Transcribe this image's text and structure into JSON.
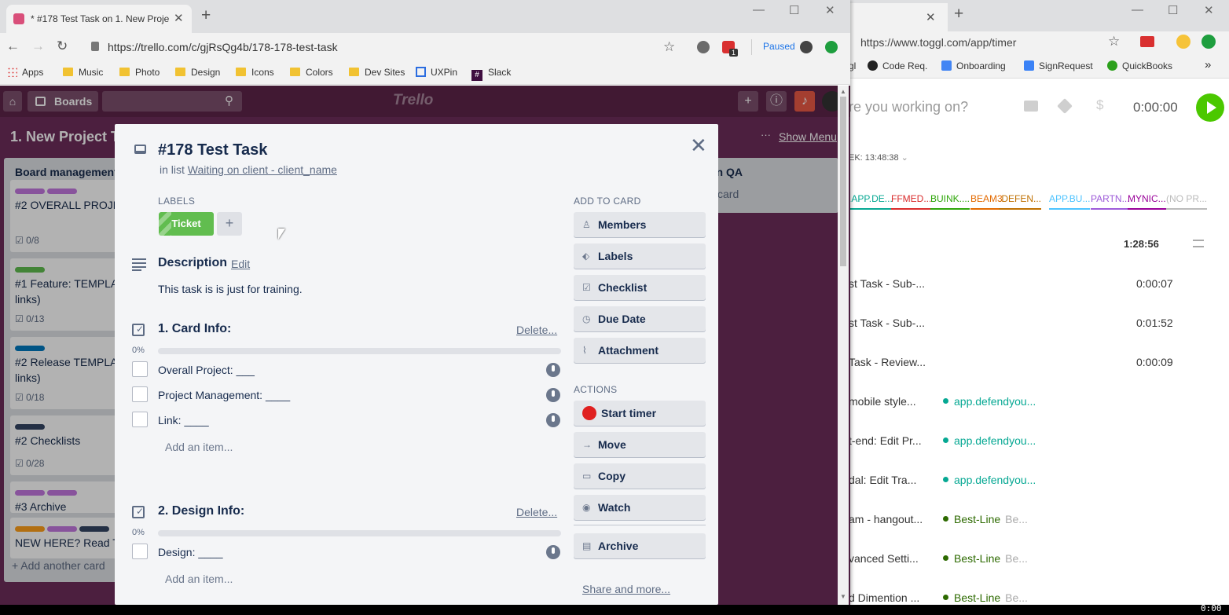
{
  "toggl_window": {
    "new_tab": "+",
    "url": "https://www.toggl.com/app/timer",
    "bookmarks": [
      "Code Req.",
      "Onboarding",
      "SignRequest",
      "QuickBooks"
    ],
    "bookmarks_more": "»",
    "prompt": "re you working on?",
    "timer": "0:00:00",
    "week_total": "EK: 13:48:38",
    "projects": [
      {
        "label": ".APP.DE...",
        "color": "#06a893"
      },
      {
        "label": "FFMED...",
        "color": "#d92b2b"
      },
      {
        "label": "BUINK....",
        "color": "#2da608"
      },
      {
        "label": "BEAM3",
        "color": "#e36a00"
      },
      {
        "label": ".DEFEN...",
        "color": "#bf7000"
      },
      {
        "label": "APP.BU...",
        "color": "#4dc3ff"
      },
      {
        "label": "PARTN...",
        "color": "#9e5bd9"
      },
      {
        "label": "MYNIC...",
        "color": "#990099"
      },
      {
        "label": "(NO PR...",
        "color": "#bbbbbb"
      }
    ],
    "day_total": "1:28:56",
    "entries": [
      {
        "desc": "st Task - Sub-...",
        "dur": "0:00:07",
        "project": "",
        "client": ""
      },
      {
        "desc": "st Task - Sub-...",
        "dur": "0:01:52",
        "project": "",
        "client": ""
      },
      {
        "desc": "Task - Review...",
        "dur": "0:00:09",
        "project": "",
        "client": ""
      },
      {
        "desc": "mobile style...",
        "dur": "",
        "project": "app.defendyou...",
        "client": "",
        "color": "#06a893"
      },
      {
        "desc": "t-end: Edit Pr...",
        "dur": "",
        "project": "app.defendyou...",
        "client": "",
        "color": "#06a893"
      },
      {
        "desc": "dal: Edit Tra...",
        "dur": "",
        "project": "app.defendyou...",
        "client": "",
        "color": "#06a893"
      },
      {
        "desc": "am - hangout...",
        "dur": "",
        "project": "Best-Line",
        "client": "Be...",
        "color": "#2d6a00"
      },
      {
        "desc": "vanced Setti...",
        "dur": "",
        "project": "Best-Line",
        "client": "Be...",
        "color": "#2d6a00"
      },
      {
        "desc": "d Dimention ...",
        "dur": "",
        "project": "Best-Line",
        "client": "Be...",
        "color": "#2d6a00"
      }
    ]
  },
  "trello_window": {
    "tab_title": "* #178 Test Task on 1. New Proje",
    "new_tab": "+",
    "url": "https://trello.com/c/gjRsQg4b/178-178-test-task",
    "extension_badge": "1",
    "paused_label": "Paused",
    "bookmarks": [
      "Apps",
      "Music",
      "Photo",
      "Design",
      "Icons",
      "Colors",
      "Dev Sites",
      "UXPin",
      "Slack"
    ],
    "header": {
      "boards": "Boards",
      "logo": "Trello"
    },
    "board": {
      "name": "1. New Project T",
      "show_menu": "Show Menu",
      "column1_title": "Board management",
      "cards": [
        {
          "title": "#2 OVERALL PROJE",
          "badge": "0/8",
          "bars": [
            "#c377e0",
            "#c377e0"
          ]
        },
        {
          "title": "#1 Feature: TEMPLA links)",
          "badge": "0/13",
          "bars": [
            "#61bd4f"
          ]
        },
        {
          "title": "#2 Release TEMPLA links)",
          "badge": "0/18",
          "bars": [
            "#0079bf"
          ]
        },
        {
          "title": "#2 Checklists",
          "badge": "0/28",
          "bars": [
            "#344563"
          ]
        },
        {
          "title": "#3 Archive",
          "badge": "",
          "bars": [
            "#c377e0",
            "#c377e0"
          ]
        },
        {
          "title": "NEW HERE? Read T",
          "badge": "",
          "bars": [
            "#ff9f1a",
            "#c377e0",
            "#344563"
          ]
        }
      ],
      "add_card": "+ Add another card",
      "column2_title": "on QA",
      "column2_sub": "card"
    },
    "modal": {
      "title": "#178 Test Task",
      "in_list_prefix": "in list",
      "in_list_link": "Waiting on client - client_name",
      "labels_heading": "Labels",
      "label_name": "Ticket",
      "label_color": "#61bd4f",
      "add_label": "+",
      "description_heading": "Description",
      "description_edit": "Edit",
      "description": "This task is is just for training.",
      "checklists": [
        {
          "title": "1. Card Info:",
          "delete": "Delete...",
          "percent": "0%",
          "progress": 0,
          "items": [
            "Overall Project: ___",
            "Project Management: ____",
            "Link: ____"
          ],
          "add": "Add an item..."
        },
        {
          "title": "2. Design Info:",
          "delete": "Delete...",
          "percent": "0%",
          "progress": 0,
          "items": [
            "Design: ____"
          ],
          "add": "Add an item..."
        }
      ],
      "add_to_card_heading": "Add to card",
      "add_to_card": [
        {
          "label": "Members",
          "icon": "person-icon"
        },
        {
          "label": "Labels",
          "icon": "tag-icon"
        },
        {
          "label": "Checklist",
          "icon": "checklist-icon"
        },
        {
          "label": "Due Date",
          "icon": "clock-icon"
        },
        {
          "label": "Attachment",
          "icon": "paperclip-icon"
        }
      ],
      "actions_heading": "Actions",
      "actions": [
        {
          "label": "Start timer",
          "icon": "power-icon"
        },
        {
          "label": "Move",
          "icon": "arrow-right-icon"
        },
        {
          "label": "Copy",
          "icon": "card-icon"
        },
        {
          "label": "Watch",
          "icon": "eye-icon"
        },
        {
          "label": "Archive",
          "icon": "archive-icon"
        }
      ],
      "share": "Share and more..."
    }
  },
  "system": {
    "clock": "0:00"
  }
}
